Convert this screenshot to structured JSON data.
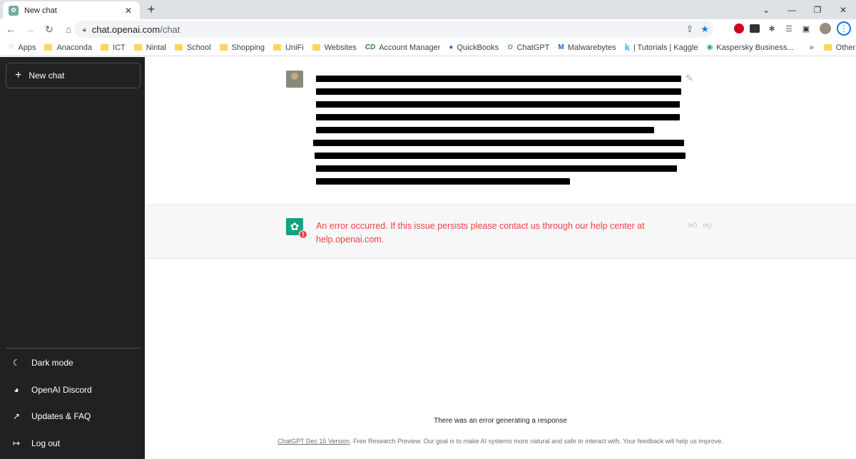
{
  "browser": {
    "tab_title": "New chat",
    "tab_close": "✕",
    "new_tab": "+",
    "url_host": "chat.openai.com",
    "url_path": "/chat"
  },
  "bookmarks": [
    "Apps",
    "Anaconda",
    "ICT",
    "Nintal",
    "School",
    "Shopping",
    "UniFi",
    "Websites",
    "Account Manager",
    "QuickBooks",
    "ChatGPT",
    "Malwarebytes",
    "| Tutorials | Kaggle",
    "Kaspersky Business...",
    "Other bookmarks"
  ],
  "bookmark_overflow": "»",
  "sidebar": {
    "new_chat": "New chat",
    "items": [
      {
        "label": "Dark mode",
        "icon": "moon-icon"
      },
      {
        "label": "OpenAI Discord",
        "icon": "discord-icon"
      },
      {
        "label": "Updates & FAQ",
        "icon": "external-link-icon"
      },
      {
        "label": "Log out",
        "icon": "logout-icon"
      }
    ]
  },
  "conversation": {
    "error_message": "An error occurred. If this issue persists please contact us through our help center at help.openai.com.",
    "error_badge": "!",
    "generation_error": "There was an error generating a response"
  },
  "footer": {
    "version_link": "ChatGPT Dec 15 Version",
    "text": ". Free Research Preview. Our goal is to make AI systems more natural and safe to interact with. Your feedback will help us improve."
  },
  "colors": {
    "sidebar_bg": "#202123",
    "error_red": "#ef4146",
    "brand_green": "#10a37f"
  }
}
